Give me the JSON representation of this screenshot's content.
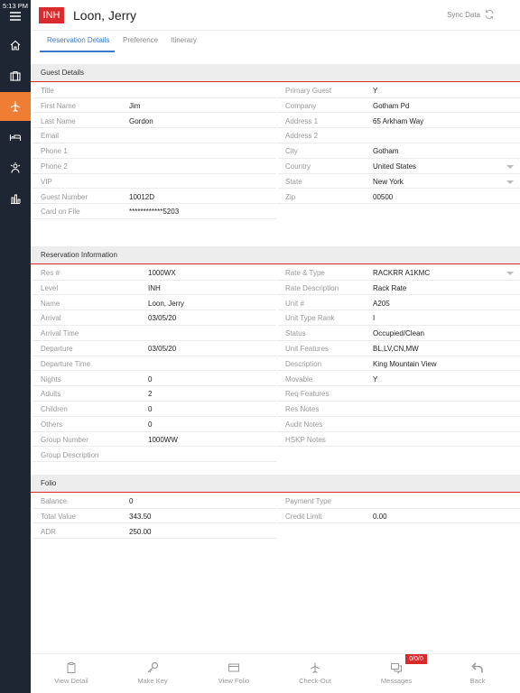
{
  "status_time": "5:13 PM",
  "header": {
    "badge": "INH",
    "title": "Loon, Jerry",
    "sync_label": "Sync Data"
  },
  "tabs": [
    {
      "label": "Reservation Details"
    },
    {
      "label": "Preference"
    },
    {
      "label": "Itinerary"
    }
  ],
  "guest_details": {
    "title": "Guest Details",
    "left": [
      {
        "label": "Title",
        "value": ""
      },
      {
        "label": "First Name",
        "value": "Jim"
      },
      {
        "label": "Last Name",
        "value": "Gordon"
      },
      {
        "label": "Email",
        "value": ""
      },
      {
        "label": "Phone 1",
        "value": ""
      },
      {
        "label": "Phone 2",
        "value": ""
      },
      {
        "label": "VIP",
        "value": ""
      },
      {
        "label": "Guest Number",
        "value": "10012D"
      },
      {
        "label": "Card on File",
        "value": "************5203"
      }
    ],
    "right": [
      {
        "label": "Primary Guest",
        "value": "Y"
      },
      {
        "label": "Company",
        "value": "Gotham Pd"
      },
      {
        "label": "Address 1",
        "value": "65 Arkham Way"
      },
      {
        "label": "Address 2",
        "value": ""
      },
      {
        "label": "City",
        "value": "Gotham"
      },
      {
        "label": "Country",
        "value": "United States"
      },
      {
        "label": "State",
        "value": "New York"
      },
      {
        "label": "Zip",
        "value": "00500"
      }
    ]
  },
  "reservation_info": {
    "title": "Reservation Information",
    "left": [
      {
        "label": "Res #",
        "value": "1000WX"
      },
      {
        "label": "Level",
        "value": "INH"
      },
      {
        "label": "Name",
        "value": "Loon, Jerry"
      },
      {
        "label": "Arrival",
        "value": "03/05/20"
      },
      {
        "label": "Arrival Time",
        "value": ""
      },
      {
        "label": "Departure",
        "value": "03/05/20"
      },
      {
        "label": "Departure Time",
        "value": ""
      },
      {
        "label": "Nights",
        "value": "0"
      },
      {
        "label": "Adults",
        "value": "2"
      },
      {
        "label": "Children",
        "value": "0"
      },
      {
        "label": "Others",
        "value": "0"
      },
      {
        "label": "Group Number",
        "value": "1000WW"
      },
      {
        "label": "Group Description",
        "value": ""
      }
    ],
    "right": [
      {
        "label": "Rate & Type",
        "value": "RACKRR   A1KMC"
      },
      {
        "label": "Rate Description",
        "value": "Rack Rate"
      },
      {
        "label": "Unit #",
        "value": "A205"
      },
      {
        "label": "Unit Type Rank",
        "value": "I"
      },
      {
        "label": "Status",
        "value": "Occupied/Clean"
      },
      {
        "label": "Unit Features",
        "value": "BL,LV,CN,MW"
      },
      {
        "label": "Description",
        "value": "King Mountain View"
      },
      {
        "label": "Movable",
        "value": "Y"
      },
      {
        "label": "Req Features",
        "value": ""
      },
      {
        "label": "Res Notes",
        "value": ""
      },
      {
        "label": "Audit Notes",
        "value": ""
      },
      {
        "label": "HSKP Notes",
        "value": ""
      }
    ]
  },
  "folio": {
    "title": "Folio",
    "left": [
      {
        "label": "Balance",
        "value": "0"
      },
      {
        "label": "Total Value",
        "value": "343.50"
      },
      {
        "label": "ADR",
        "value": "250.00"
      }
    ],
    "right": [
      {
        "label": "Payment Type",
        "value": ""
      },
      {
        "label": "Credit Limit",
        "value": "0.00"
      }
    ]
  },
  "toolbar": [
    {
      "label": "View Detail",
      "icon": "clipboard-icon"
    },
    {
      "label": "Make Key",
      "icon": "key-icon"
    },
    {
      "label": "View Folio",
      "icon": "card-icon"
    },
    {
      "label": "Check-Out",
      "icon": "airplane-icon"
    },
    {
      "label": "Messages",
      "icon": "chat-icon"
    },
    {
      "label": "Back",
      "icon": "back-arrow-icon"
    }
  ],
  "messages_badge": "0/0/0",
  "colors": {
    "sidebar": "#1f2633",
    "sidebar_active": "#ef7d34",
    "accent_red": "#d92b2b",
    "tab_blue": "#3a79c9"
  }
}
